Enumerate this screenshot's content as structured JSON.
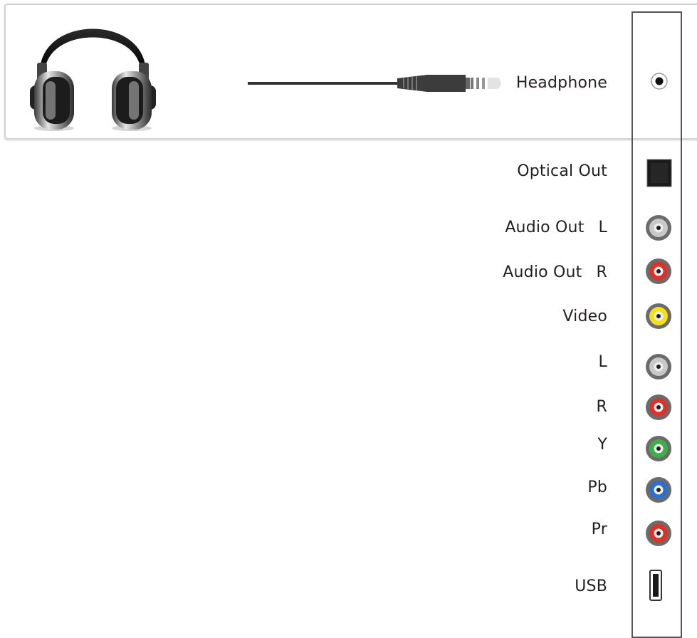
{
  "headphone": {
    "label": "Headphone"
  },
  "ports": [
    {
      "id": "optical",
      "label": "Optical Out",
      "suffix": "",
      "kind": "optical"
    },
    {
      "id": "audio-out-l",
      "label": "Audio Out",
      "suffix": "L",
      "kind": "rca",
      "color": "#c8c8c8"
    },
    {
      "id": "audio-out-r",
      "label": "Audio Out",
      "suffix": "R",
      "kind": "rca",
      "color": "#d9342b"
    },
    {
      "id": "video",
      "label": "Video",
      "suffix": "",
      "kind": "rca",
      "color": "#f5e11a"
    },
    {
      "id": "l",
      "label": "L",
      "suffix": "",
      "kind": "rca",
      "color": "#c8c8c8"
    },
    {
      "id": "r",
      "label": "R",
      "suffix": "",
      "kind": "rca",
      "color": "#d9342b"
    },
    {
      "id": "y",
      "label": "Y",
      "suffix": "",
      "kind": "rca",
      "color": "#3fae49"
    },
    {
      "id": "pb",
      "label": "Pb",
      "suffix": "",
      "kind": "rca",
      "color": "#2f6fc6"
    },
    {
      "id": "pr",
      "label": "Pr",
      "suffix": "",
      "kind": "rca",
      "color": "#d9342b"
    },
    {
      "id": "usb",
      "label": "USB",
      "suffix": "",
      "kind": "usb"
    }
  ]
}
